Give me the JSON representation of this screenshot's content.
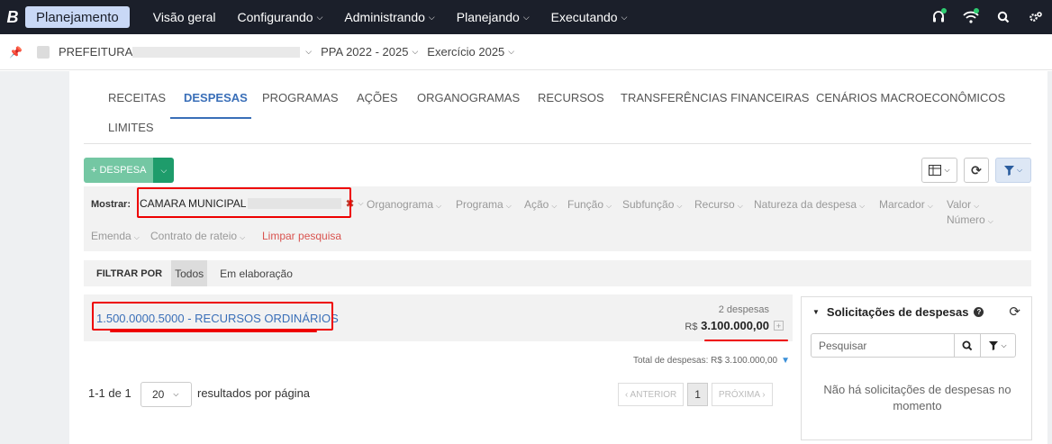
{
  "topbar": {
    "brand_letter": "B",
    "app_name": "Planejamento",
    "nav": [
      {
        "label": "Visão geral",
        "dropdown": false
      },
      {
        "label": "Configurando",
        "dropdown": true
      },
      {
        "label": "Administrando",
        "dropdown": true
      },
      {
        "label": "Planejando",
        "dropdown": true
      },
      {
        "label": "Executando",
        "dropdown": true
      }
    ],
    "icons": [
      "headset-icon",
      "wifi-icon",
      "search-icon",
      "gears-icon"
    ]
  },
  "context": {
    "entity": "PREFEITURA",
    "ppa": "PPA 2022 - 2025",
    "exercise": "Exercício 2025"
  },
  "tabs": [
    "RECEITAS",
    "DESPESAS",
    "PROGRAMAS",
    "AÇÕES",
    "ORGANOGRAMAS",
    "RECURSOS",
    "TRANSFERÊNCIAS FINANCEIRAS",
    "CENÁRIOS MACROECONÔMICOS",
    "LIMITES"
  ],
  "active_tab": "DESPESAS",
  "toolbar": {
    "add_label": "+ DESPESA"
  },
  "filters": {
    "label": "Mostrar:",
    "active_chip": "CAMARA MUNICIPAL",
    "options": [
      "Organograma",
      "Programa",
      "Ação",
      "Função",
      "Subfunção",
      "Recurso",
      "Natureza da despesa",
      "Marcador",
      "Valor",
      "Número",
      "Emenda",
      "Contrato de rateio"
    ],
    "clear_label": "Limpar pesquisa"
  },
  "filtrar_por": {
    "label": "FILTRAR POR",
    "options": [
      "Todos",
      "Em elaboração"
    ],
    "selected": "Todos"
  },
  "result": {
    "title": "1.500.0000.5000 - RECURSOS ORDINÁRIOS",
    "count": "2 despesas",
    "currency": "R$",
    "total": "3.100.000,00"
  },
  "summary": {
    "total_text": "Total de despesas: R$ 3.100.000,00"
  },
  "pagination": {
    "range": "1-1 de 1",
    "page_size": "20",
    "per_page_label": "resultados por página",
    "prev": "‹ ANTERIOR",
    "current": "1",
    "next": "PRÓXIMA ›"
  },
  "side_panel": {
    "title": "Solicitações de despesas",
    "search_placeholder": "Pesquisar",
    "empty_text": "Não há solicitações de despesas no momento"
  },
  "colors": {
    "topbar": "#1b1f2a",
    "accent_blue": "#3a6fb8",
    "green": "#1e9c6b",
    "highlight_red": "#ee0000"
  }
}
